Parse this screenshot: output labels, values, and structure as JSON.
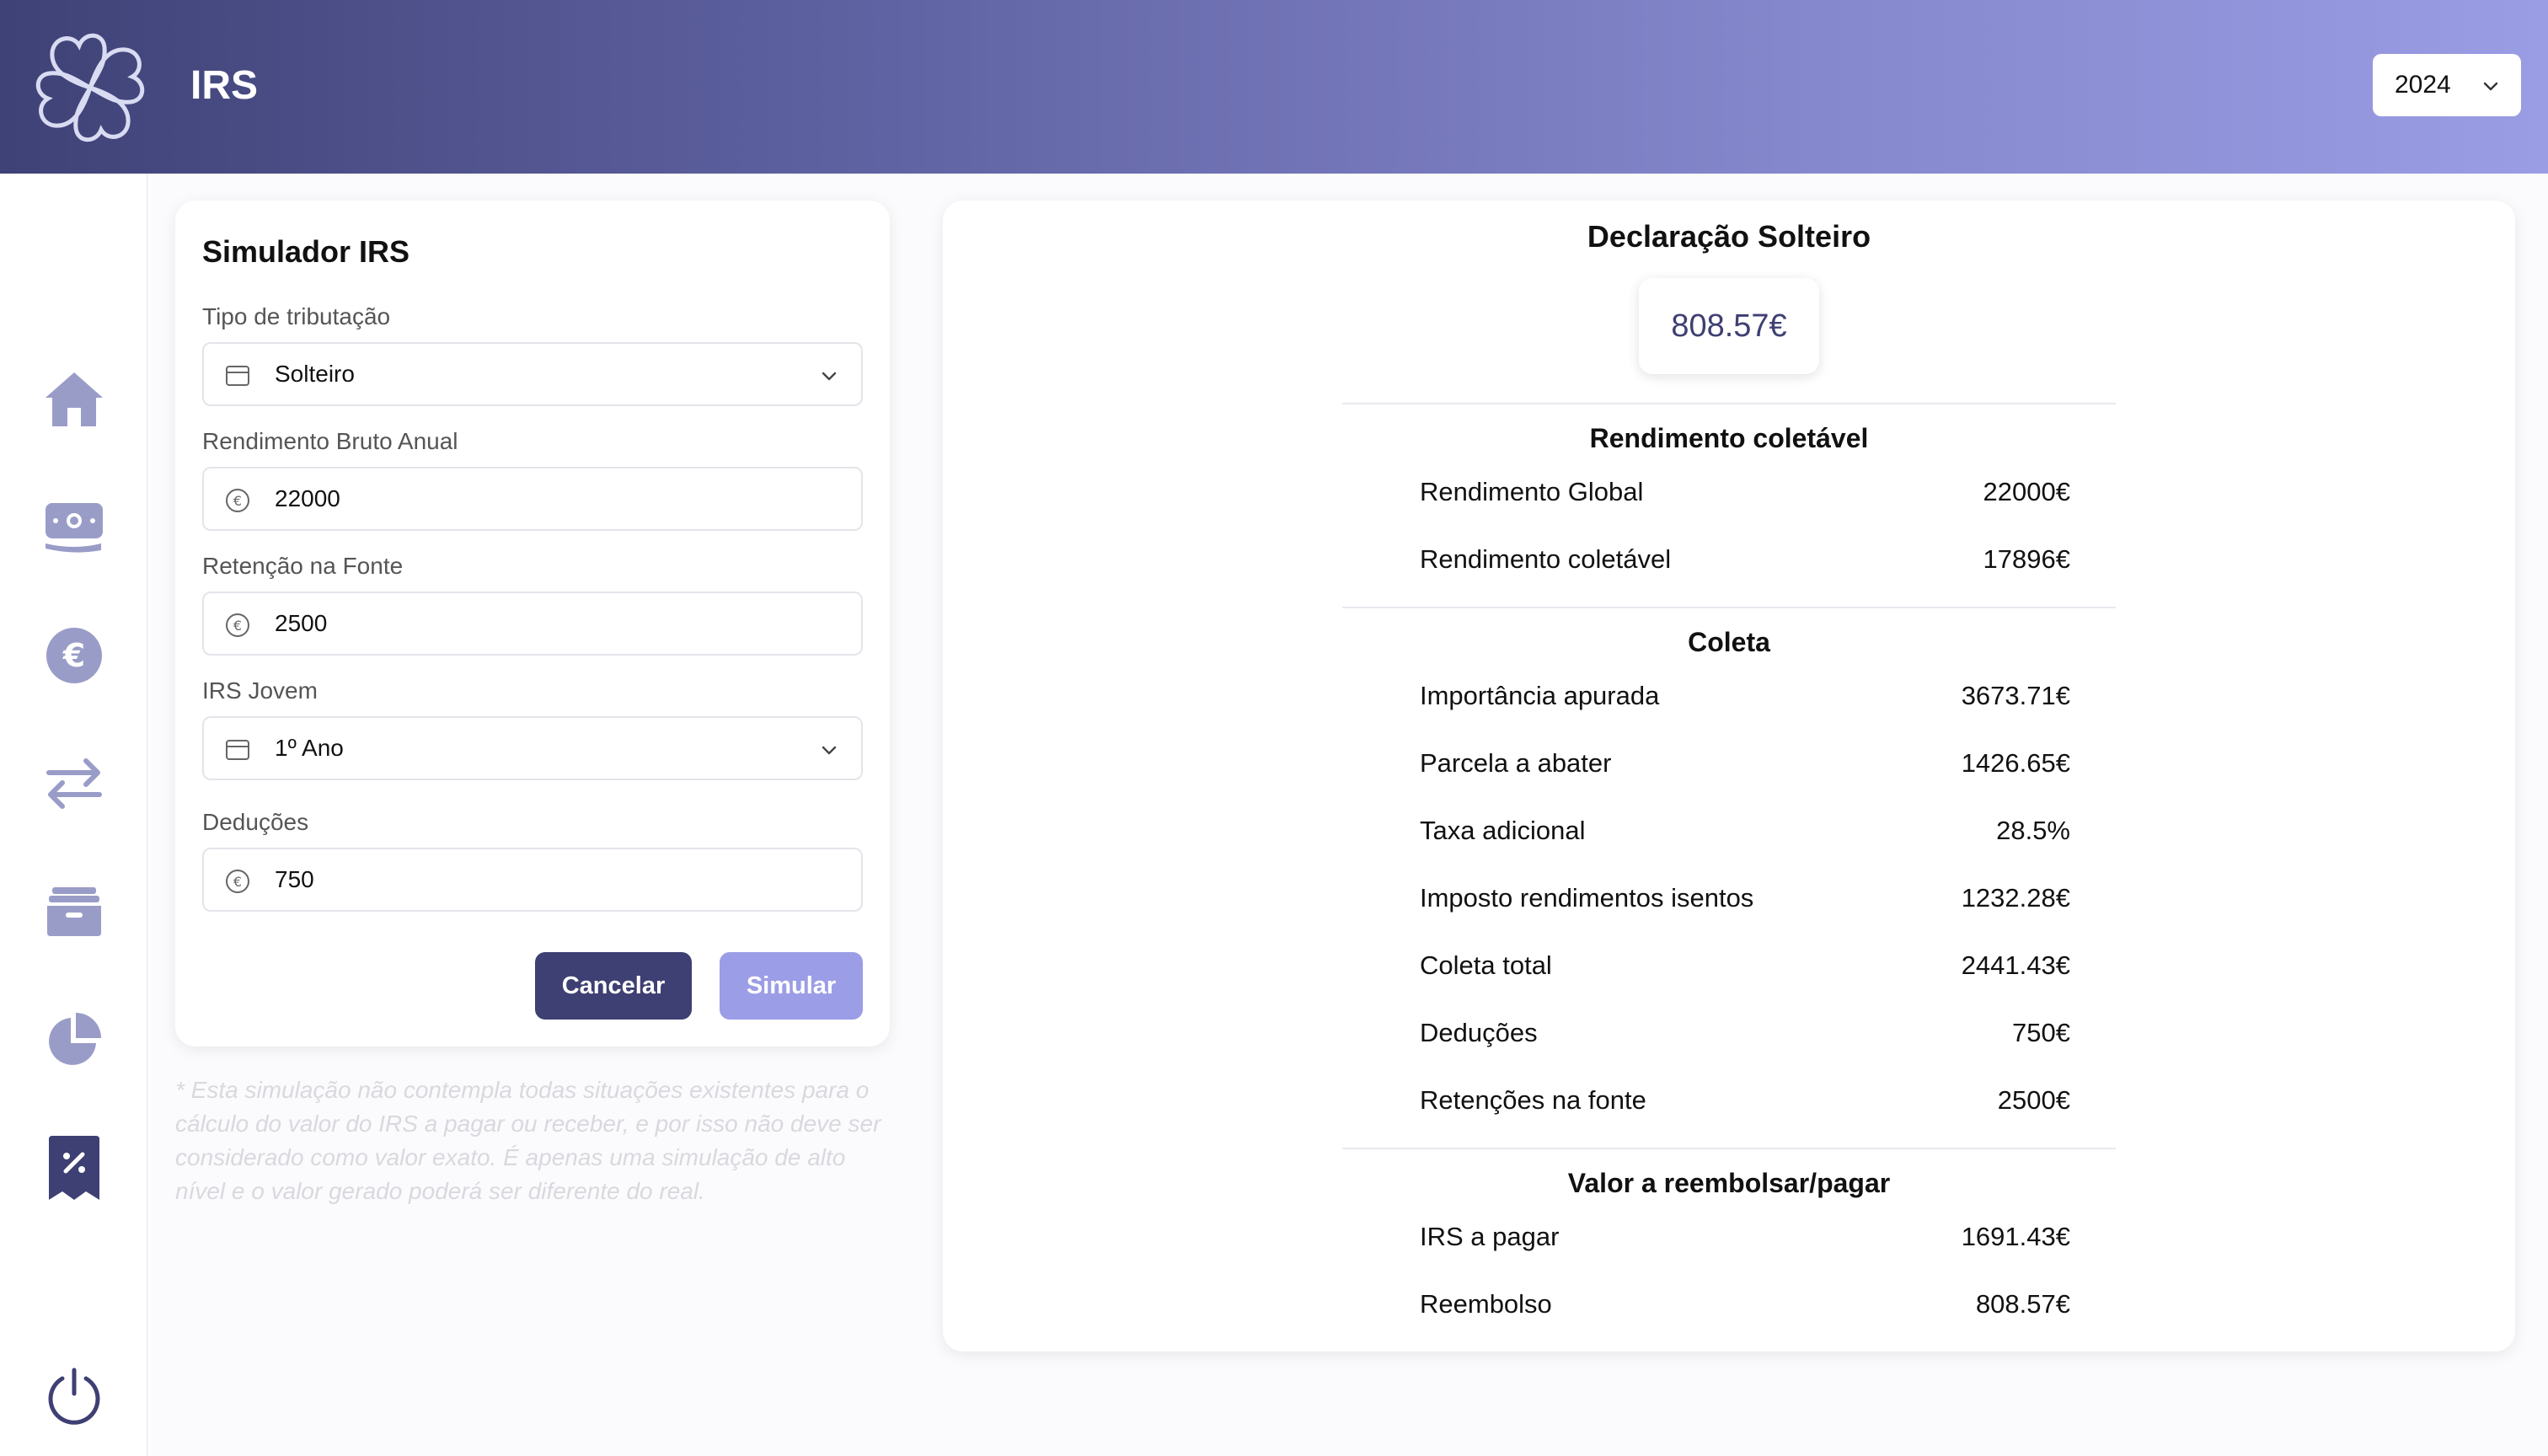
{
  "header": {
    "app_title": "IRS",
    "year": "2024"
  },
  "sidebar": {
    "items": [
      {
        "icon": "home-icon"
      },
      {
        "icon": "money-icon"
      },
      {
        "icon": "euro-icon"
      },
      {
        "icon": "transfer-icon"
      },
      {
        "icon": "wallet-icon"
      },
      {
        "icon": "pie-chart-icon"
      },
      {
        "icon": "tax-receipt-icon"
      }
    ],
    "logout_icon": "power-icon"
  },
  "simulator": {
    "title": "Simulador IRS",
    "fields": {
      "tipo": {
        "label": "Tipo de tributação",
        "value": "Solteiro"
      },
      "rendimento": {
        "label": "Rendimento Bruto Anual",
        "value": "22000"
      },
      "retencao": {
        "label": "Retenção na Fonte",
        "value": "2500"
      },
      "jovem": {
        "label": "IRS Jovem",
        "value": "1º Ano"
      },
      "deducoes": {
        "label": "Deduções",
        "value": "750"
      }
    },
    "cancel_label": "Cancelar",
    "simulate_label": "Simular",
    "disclaimer": "* Esta simulação não contempla todas situações existentes para o cálculo do valor do IRS a pagar ou receber, e por isso não deve ser considerado como valor exato. É apenas uma simulação de alto nível e o valor gerado poderá ser diferente do real."
  },
  "result": {
    "title": "Declaração Solteiro",
    "amount": "808.57€",
    "sections": [
      {
        "title": "Rendimento coletável",
        "rows": [
          {
            "label": "Rendimento Global",
            "value": "22000€"
          },
          {
            "label": "Rendimento coletável",
            "value": "17896€"
          }
        ]
      },
      {
        "title": "Coleta",
        "rows": [
          {
            "label": "Importância apurada",
            "value": "3673.71€"
          },
          {
            "label": "Parcela a abater",
            "value": "1426.65€"
          },
          {
            "label": "Taxa adicional",
            "value": "28.5%"
          },
          {
            "label": "Imposto rendimentos isentos",
            "value": "1232.28€"
          },
          {
            "label": "Coleta total",
            "value": "2441.43€"
          },
          {
            "label": "Deduções",
            "value": "750€"
          },
          {
            "label": "Retenções na fonte",
            "value": "2500€"
          }
        ]
      },
      {
        "title": "Valor a reembolsar/pagar",
        "rows": [
          {
            "label": "IRS a pagar",
            "value": "1691.43€"
          },
          {
            "label": "Reembolso",
            "value": "808.57€"
          }
        ]
      }
    ]
  },
  "colors": {
    "accent_dark": "#3e3f72",
    "accent_light": "#9b9de6",
    "nav_icon": "#9a9cc8"
  }
}
